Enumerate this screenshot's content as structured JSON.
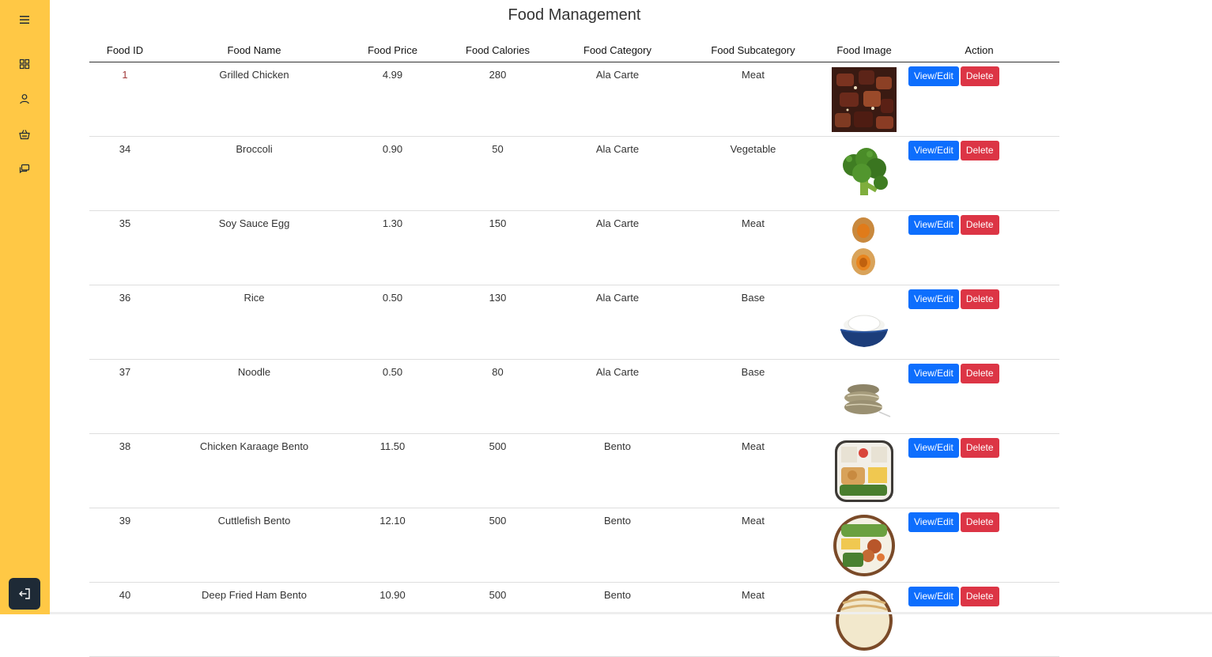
{
  "page": {
    "title": "Food Management"
  },
  "sidebar": {
    "icons": [
      "hamburger-menu-icon",
      "dashboard-grid-icon",
      "user-icon",
      "shopping-basket-icon",
      "chat-bubbles-icon",
      "logout-icon"
    ]
  },
  "table": {
    "headers": [
      "Food ID",
      "Food Name",
      "Food Price",
      "Food Calories",
      "Food Category",
      "Food Subcategory",
      "Food Image",
      "Action"
    ],
    "action_labels": {
      "view": "View/Edit",
      "delete": "Delete"
    },
    "rows": [
      {
        "id": "1",
        "name": "Grilled Chicken",
        "price": "4.99",
        "calories": "280",
        "category": "Ala Carte",
        "subcategory": "Meat"
      },
      {
        "id": "34",
        "name": "Broccoli",
        "price": "0.90",
        "calories": "50",
        "category": "Ala Carte",
        "subcategory": "Vegetable"
      },
      {
        "id": "35",
        "name": "Soy Sauce Egg",
        "price": "1.30",
        "calories": "150",
        "category": "Ala Carte",
        "subcategory": "Meat"
      },
      {
        "id": "36",
        "name": "Rice",
        "price": "0.50",
        "calories": "130",
        "category": "Ala Carte",
        "subcategory": "Base"
      },
      {
        "id": "37",
        "name": "Noodle",
        "price": "0.50",
        "calories": "80",
        "category": "Ala Carte",
        "subcategory": "Base"
      },
      {
        "id": "38",
        "name": "Chicken Karaage Bento",
        "price": "11.50",
        "calories": "500",
        "category": "Bento",
        "subcategory": "Meat"
      },
      {
        "id": "39",
        "name": "Cuttlefish Bento",
        "price": "12.10",
        "calories": "500",
        "category": "Bento",
        "subcategory": "Meat"
      },
      {
        "id": "40",
        "name": "Deep Fried Ham Bento",
        "price": "10.90",
        "calories": "500",
        "category": "Bento",
        "subcategory": "Meat"
      }
    ]
  },
  "colors": {
    "sidebar": "#ffc845",
    "view_button": "#0d6efd",
    "delete_button": "#dc3545"
  }
}
